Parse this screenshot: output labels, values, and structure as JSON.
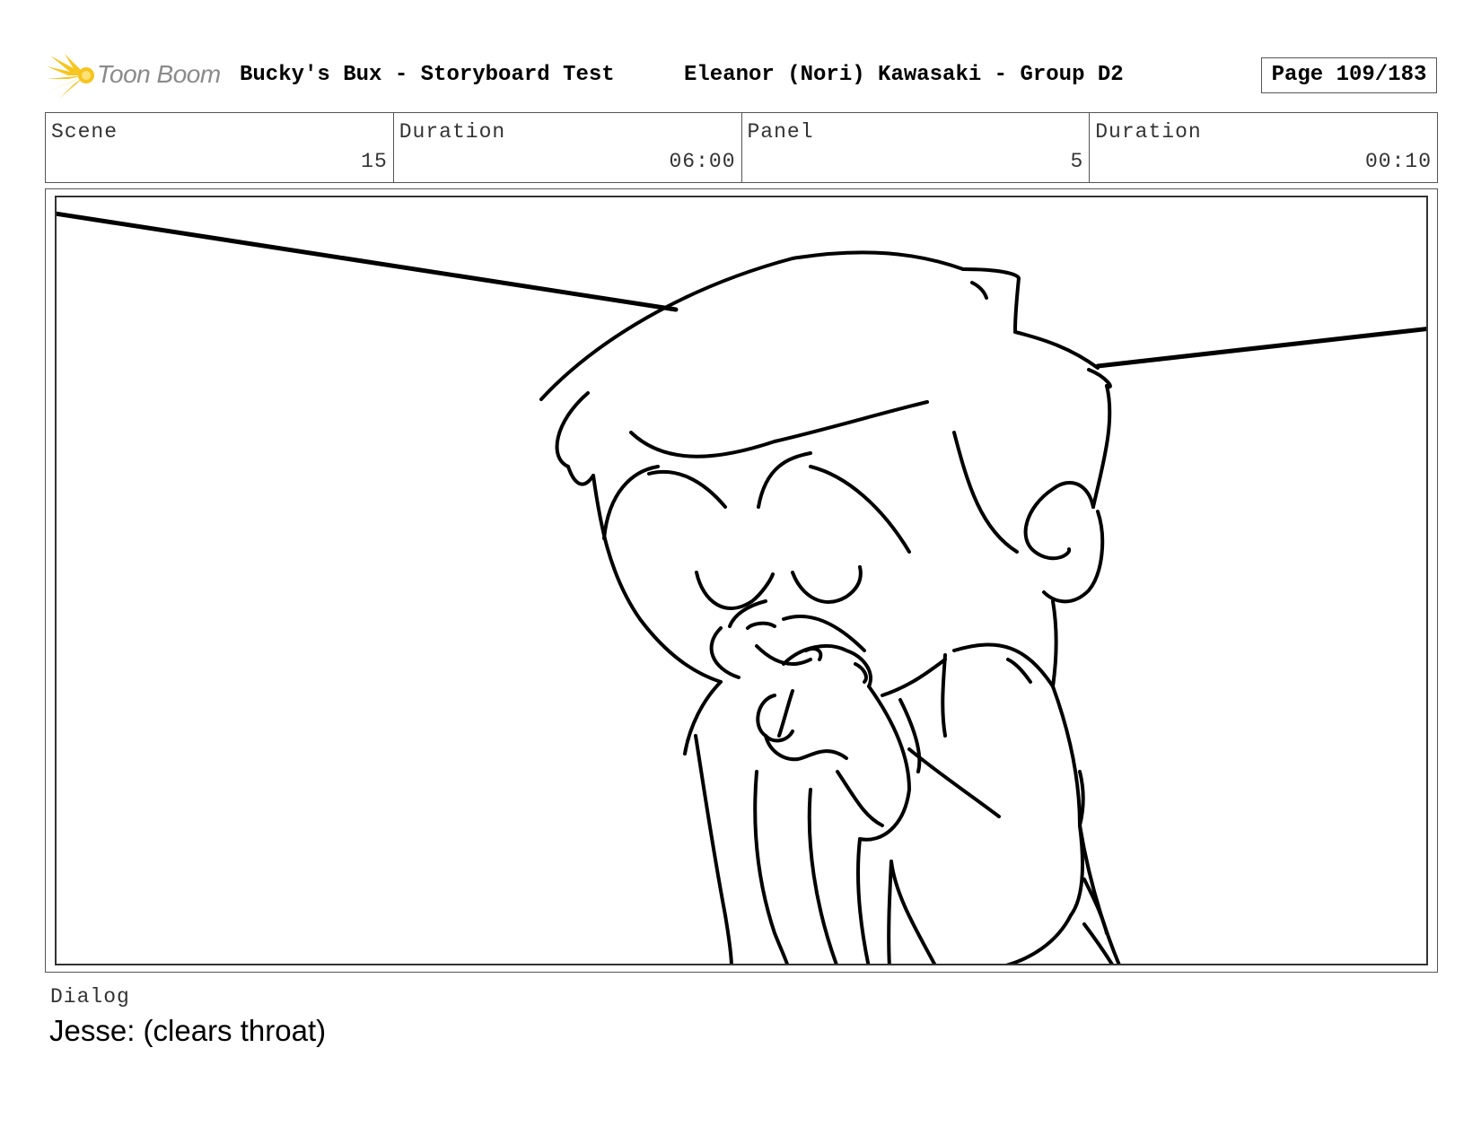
{
  "header": {
    "logo_text": "Toon Boom",
    "logo_icon": "star-burst-icon",
    "title": "Bucky's Bux - Storyboard Test",
    "artist": "Eleanor (Nori) Kawasaki - Group D2",
    "page": "Page 109/183"
  },
  "info": {
    "scene_label": "Scene",
    "scene_value": "15",
    "scene_duration_label": "Duration",
    "scene_duration_value": "06:00",
    "panel_label": "Panel",
    "panel_value": "5",
    "panel_duration_label": "Duration",
    "panel_duration_value": "00:10"
  },
  "panel": {
    "drawing": "sketch-character-clearing-throat"
  },
  "dialog": {
    "label": "Dialog",
    "text": "Jesse: (clears throat)"
  },
  "colors": {
    "logo_yellow": "#f7c51e",
    "logo_text": "#8a8a8a",
    "border": "#555555"
  }
}
